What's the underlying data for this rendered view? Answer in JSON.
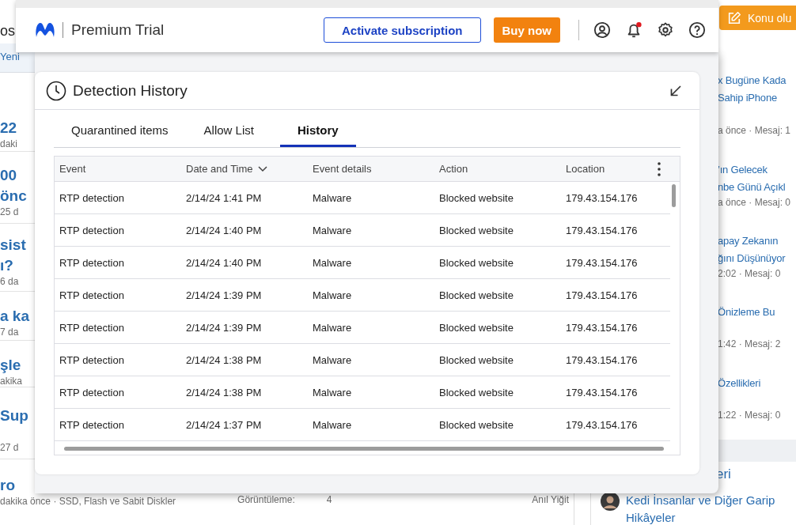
{
  "background_page": {
    "heading": "os",
    "tab": "Yeni",
    "threads": [
      {
        "title_lines": [
          "22"
        ],
        "meta": "daki"
      },
      {
        "title_lines": [
          "00",
          "önc"
        ],
        "meta": "25 d"
      },
      {
        "title_lines": [
          "sist",
          "ı?"
        ],
        "meta": "6 da"
      },
      {
        "title_lines": [
          "a ka"
        ],
        "meta": "7 da"
      },
      {
        "title_lines": [
          "şle"
        ],
        "meta": "akika"
      },
      {
        "title_lines": [
          "Sup"
        ],
        "meta": "27 d"
      },
      {
        "title_lines": [
          "ro"
        ],
        "meta": "dakika önce · SSD, Flash ve Sabit Diskler",
        "views_label": "Görüntüleme:",
        "views": "4",
        "author": "Anıl Yiğit"
      }
    ],
    "new_thread_button": "Konu olu",
    "sidebar_threads": [
      {
        "title_lines": [
          "x Bugüne Kada",
          "Sahip iPhone"
        ],
        "meta": "a önce · Mesaj: 1"
      },
      {
        "title_lines": [
          "’ın Gelecek",
          "nbe Günü Açıkl"
        ],
        "meta": "a önce · Mesaj: 0"
      },
      {
        "title_lines": [
          "apay Zekanın",
          "ğını Düşünüyor"
        ],
        "meta": "2:02 · Mesaj: 0"
      },
      {
        "title_lines": [
          "Önizleme Bu"
        ],
        "meta": "1:42 · Mesaj: 2"
      },
      {
        "title_lines": [
          "Özellikleri"
        ],
        "meta": "1:22 · Mesaj: 0"
      }
    ],
    "sidebar_section_title": "eri",
    "sidebar_item": {
      "title_lines": [
        "Kedi İnsanlar ve Diğer Garip",
        "Hikâyeler"
      ]
    }
  },
  "app": {
    "plan": "Premium Trial",
    "activate_button": "Activate subscription",
    "buy_button": "Buy now",
    "notification_unread": true
  },
  "panel": {
    "title": "Detection History",
    "tabs": [
      {
        "label": "Quarantined items",
        "selected": false
      },
      {
        "label": "Allow List",
        "selected": false
      },
      {
        "label": "History",
        "selected": true
      }
    ],
    "table": {
      "columns": [
        {
          "label": "Event",
          "sorted": false
        },
        {
          "label": "Date and Time",
          "sorted": true
        },
        {
          "label": "Event details",
          "sorted": false
        },
        {
          "label": "Action",
          "sorted": false
        },
        {
          "label": "Location",
          "sorted": false
        }
      ],
      "rows": [
        [
          "RTP detection",
          "2/14/24 1:41 PM",
          "Malware",
          "Blocked website",
          "179.43.154.176"
        ],
        [
          "RTP detection",
          "2/14/24 1:40 PM",
          "Malware",
          "Blocked website",
          "179.43.154.176"
        ],
        [
          "RTP detection",
          "2/14/24 1:40 PM",
          "Malware",
          "Blocked website",
          "179.43.154.176"
        ],
        [
          "RTP detection",
          "2/14/24 1:39 PM",
          "Malware",
          "Blocked website",
          "179.43.154.176"
        ],
        [
          "RTP detection",
          "2/14/24 1:39 PM",
          "Malware",
          "Blocked website",
          "179.43.154.176"
        ],
        [
          "RTP detection",
          "2/14/24 1:38 PM",
          "Malware",
          "Blocked website",
          "179.43.154.176"
        ],
        [
          "RTP detection",
          "2/14/24 1:38 PM",
          "Malware",
          "Blocked website",
          "179.43.154.176"
        ],
        [
          "RTP detection",
          "2/14/24 1:37 PM",
          "Malware",
          "Blocked website",
          "179.43.154.176"
        ]
      ]
    }
  }
}
